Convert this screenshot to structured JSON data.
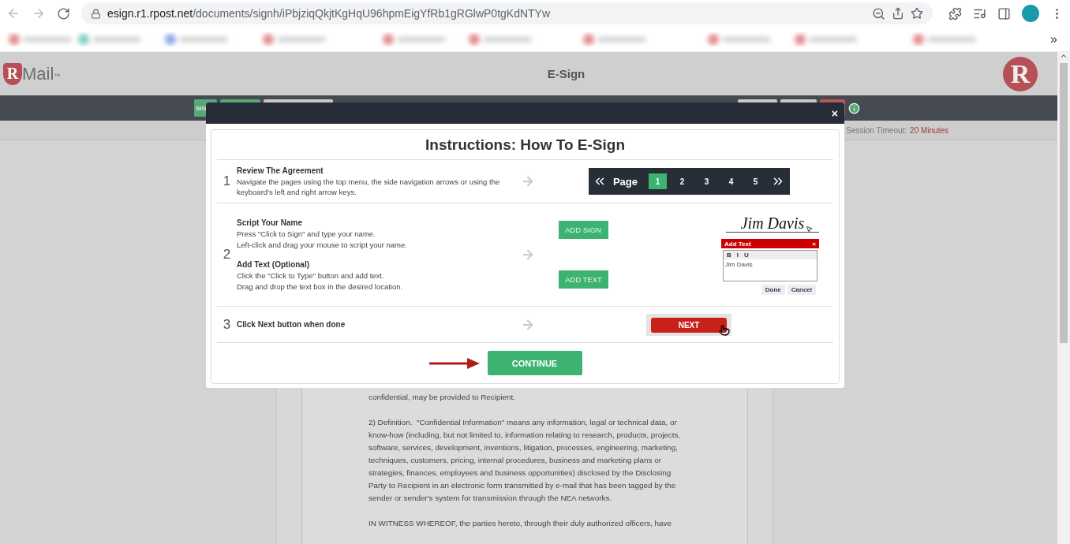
{
  "browser": {
    "url_host": "esign.r1.rpost.net",
    "url_path": "/documents/signh/iPbjziqQkjtKgHqU96hpmEigYfRb1gRGlwP0tgKdNTYw",
    "bookmarks_overflow": "»"
  },
  "header": {
    "logo_letter": "R",
    "logo_text": "Mail",
    "logo_tm": "™",
    "title": "E-Sign",
    "badge_letter": "R"
  },
  "toolbar": {
    "first_button": "SIG"
  },
  "session": {
    "label": "Session Timeout:",
    "value": "20",
    "unit": "Minutes"
  },
  "document": {
    "paragraphs": [
      "confidential, may be provided to Recipient.",
      "2) Definition.  \"Confidential Information\" means any information, legal or technical data, or know-how (including, but not limited to, information relating to research, products, projects, software, services, development, inventions, litigation, processes, engineering, marketing, techniques, customers, pricing, internal procedures, business and marketing plans or strategies, finances, employees and business opportunities) disclosed by the Disclosing Party to Recipient in an electronic form transmitted by e-mail that has been tagged by the sender or sender's system for transmission through the NEA networks.",
      "IN WITNESS WHEREOF, the parties hereto, through their duly authorized officers, have"
    ]
  },
  "modal": {
    "close": "×",
    "title": "Instructions: How To E-Sign",
    "steps": [
      {
        "number": "1",
        "kind": "pager",
        "sections": [
          {
            "heading": "Review The Agreement",
            "lines": [
              "Navigate the pages using the top menu, the side navigation arrows or using the keyboard's left and right arrow keys."
            ]
          }
        ],
        "pager": {
          "label": "Page",
          "pages": [
            {
              "label": "1",
              "selected": true
            },
            {
              "label": "2",
              "selected": false
            },
            {
              "label": "3",
              "selected": false
            },
            {
              "label": "4",
              "selected": false
            },
            {
              "label": "5",
              "selected": false
            }
          ]
        }
      },
      {
        "number": "2",
        "kind": "sign",
        "sections": [
          {
            "heading": "Script Your Name",
            "lines": [
              "Press \"Click to Sign\" and type your name.",
              "Left-click and drag your mouse to script your name."
            ]
          },
          {
            "heading": "Add Text (Optional)",
            "lines": [
              "Click the \"Click to Type\" button and add text.",
              "Drag and drop the text box in the desired location."
            ]
          }
        ],
        "buttons": [
          "ADD SIGN",
          "ADD TEXT"
        ],
        "signature": "Jim Davis",
        "dialog": {
          "title": "Add Text",
          "close": "×",
          "tools": [
            "B",
            "I",
            "U"
          ],
          "value": "Jim Davis",
          "buttons": [
            "Done",
            "Cancel"
          ]
        }
      },
      {
        "number": "3",
        "kind": "next",
        "sections": [
          {
            "heading": "Click Next button when done"
          }
        ],
        "next": "NEXT"
      }
    ],
    "continue": "CONTINUE"
  }
}
